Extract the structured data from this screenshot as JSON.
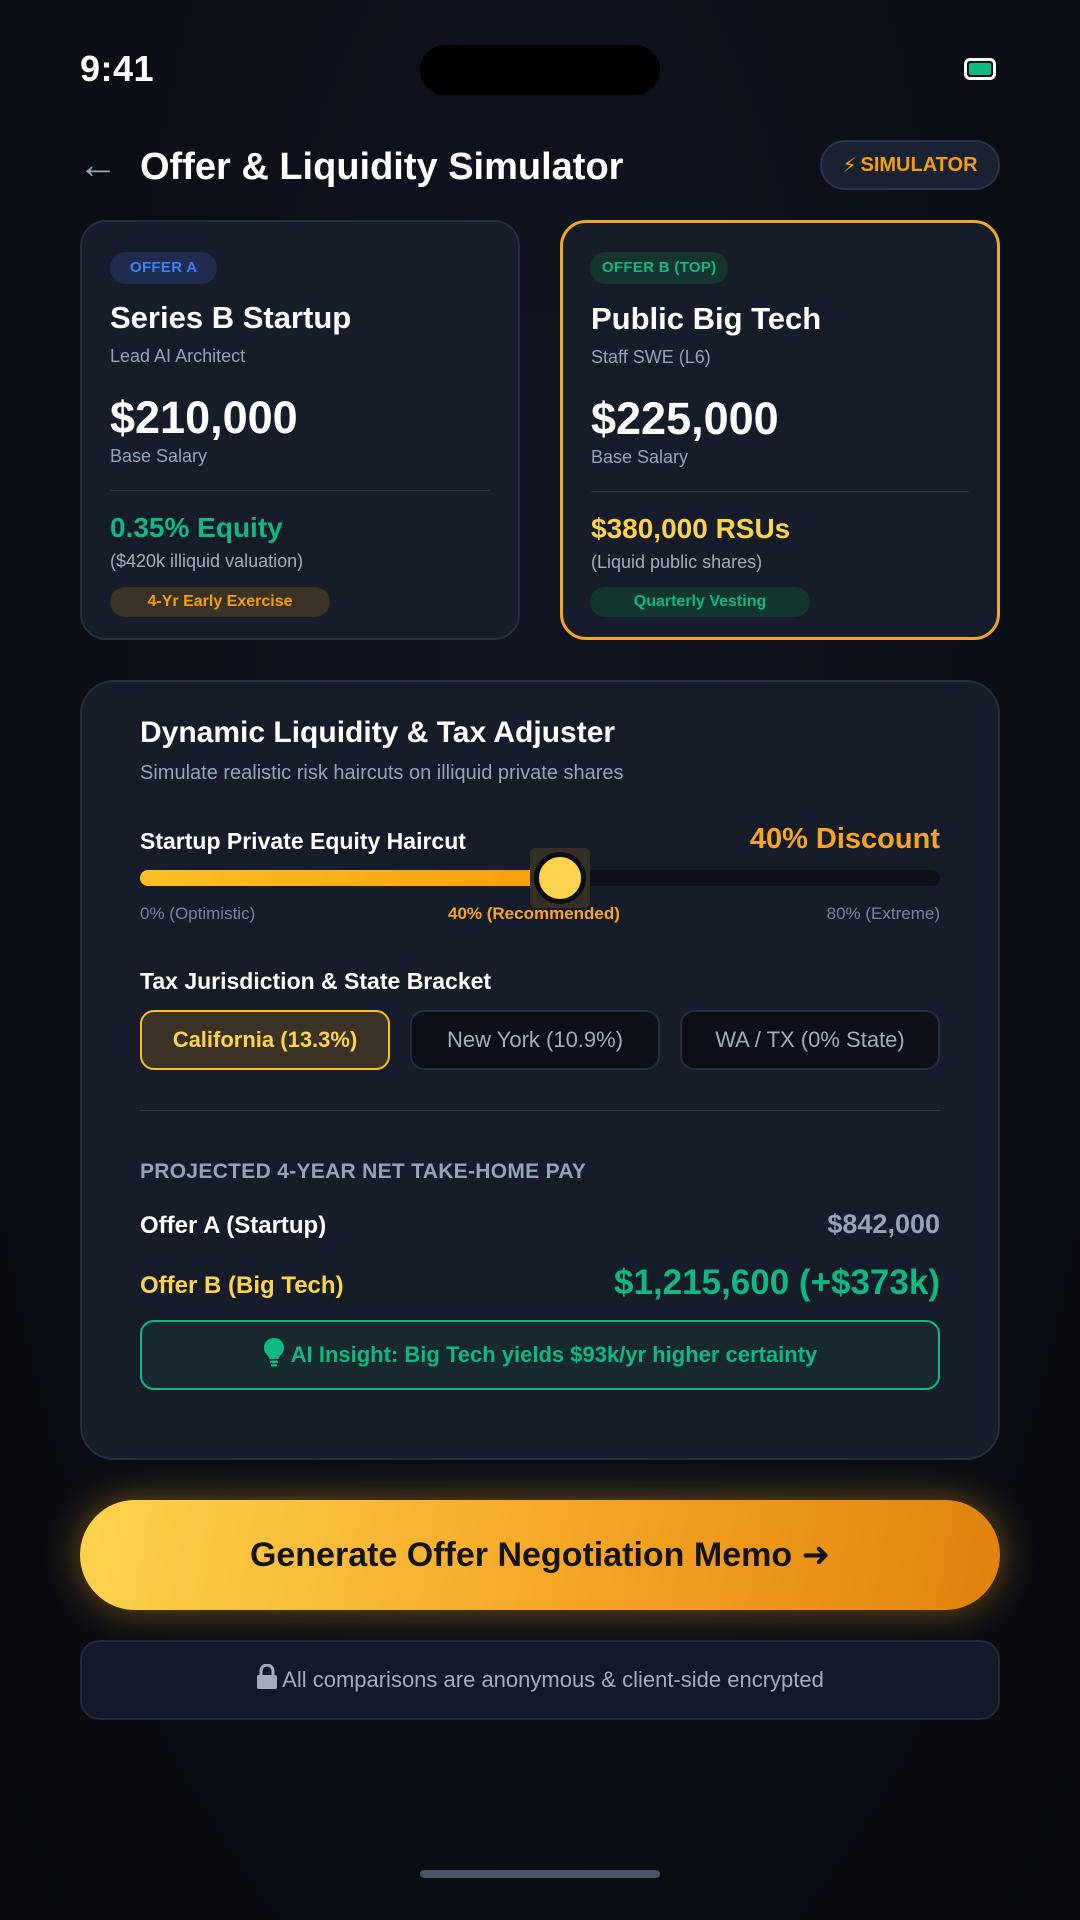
{
  "status_bar": {
    "time": "9:41"
  },
  "header": {
    "title": "Offer & Liquidity Simulator",
    "simulator_button": "SIMULATOR",
    "back_icon": "arrow-left-icon"
  },
  "offers": [
    {
      "badge": "OFFER A",
      "company": "Series B Startup",
      "role": "Lead AI Architect",
      "salary": "$210,000",
      "salary_label": "Base Salary",
      "equity": "0.35% Equity",
      "equity_note": "($420k illiquid valuation)",
      "pill": "4-Yr Early Exercise"
    },
    {
      "badge": "OFFER B (TOP)",
      "company": "Public Big Tech",
      "role": "Staff SWE (L6)",
      "salary": "$225,000",
      "salary_label": "Base Salary",
      "equity": "$380,000 RSUs",
      "equity_note": "(Liquid public shares)",
      "pill": "Quarterly Vesting"
    }
  ],
  "adjuster": {
    "title": "Dynamic Liquidity & Tax Adjuster",
    "subtitle": "Simulate realistic risk haircuts on illiquid private shares",
    "haircut": {
      "label": "Startup Private Equity Haircut",
      "value_text": "40% Discount",
      "value": 40,
      "min": 0,
      "max": 80,
      "ticks": [
        "0% (Optimistic)",
        "40% (Recommended)",
        "80% (Extreme)"
      ]
    },
    "tax": {
      "label": "Tax Jurisdiction & State Bracket",
      "options": [
        "California (13.3%)",
        "New York (10.9%)",
        "WA / TX (0% State)"
      ],
      "selected": "California (13.3%)"
    },
    "projection": {
      "label": "PROJECTED 4-YEAR NET TAKE-HOME PAY",
      "offer_a_label": "Offer A (Startup)",
      "offer_a_value": "$842,000",
      "offer_b_label": "Offer B (Big Tech)",
      "offer_b_value": "$1,215,600 (+$373k)"
    },
    "insight": "AI Insight: Big Tech yields $93k/yr higher certainty"
  },
  "cta": {
    "label": "Generate Offer Negotiation Memo ➜"
  },
  "footer_note": "All comparisons are anonymous & client-side encrypted",
  "colors": {
    "accent": "#f5a524",
    "success": "#10b981",
    "gold": "#fcd34d",
    "info": "#3b82f6",
    "card": "#171c2b"
  }
}
